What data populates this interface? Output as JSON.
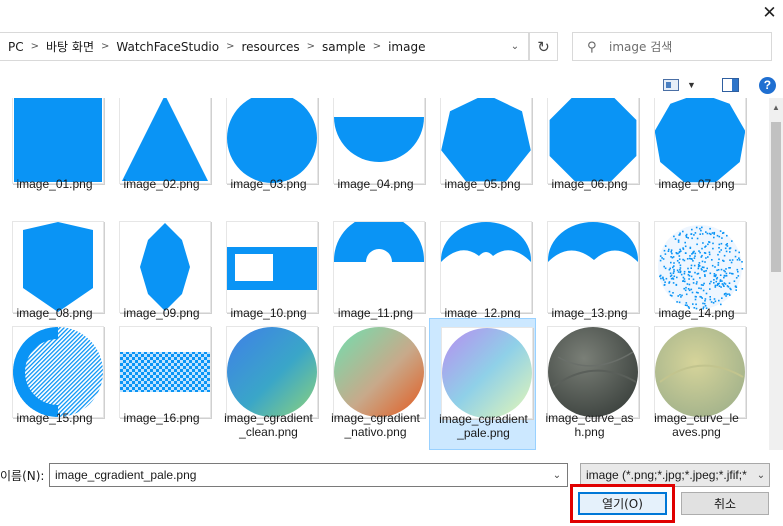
{
  "window": {
    "close_label": "✕"
  },
  "breadcrumb": {
    "items": [
      "PC",
      "바탕 화면",
      "WatchFaceStudio",
      "resources",
      "sample",
      "image"
    ]
  },
  "search": {
    "placeholder": "image 검색"
  },
  "files": [
    {
      "name": "image_01.png",
      "shape": "square"
    },
    {
      "name": "image_02.png",
      "shape": "triangle"
    },
    {
      "name": "image_03.png",
      "shape": "circle"
    },
    {
      "name": "image_04.png",
      "shape": "half-circle"
    },
    {
      "name": "image_05.png",
      "shape": "heptagon"
    },
    {
      "name": "image_06.png",
      "shape": "octagon"
    },
    {
      "name": "image_07.png",
      "shape": "nonagon"
    },
    {
      "name": "image_08.png",
      "shape": "shield"
    },
    {
      "name": "image_09.png",
      "shape": "lens"
    },
    {
      "name": "image_10.png",
      "shape": "frame"
    },
    {
      "name": "image_11.png",
      "shape": "arc"
    },
    {
      "name": "image_12.png",
      "shape": "double-arc"
    },
    {
      "name": "image_13.png",
      "shape": "double-arc-2"
    },
    {
      "name": "image_14.png",
      "shape": "noise-circle"
    },
    {
      "name": "image_15.png",
      "shape": "ring-half"
    },
    {
      "name": "image_16.png",
      "shape": "checker"
    },
    {
      "name": "image_cgradient_clean.png",
      "shape": "grad-clean"
    },
    {
      "name": "image_cgradient_nativo.png",
      "shape": "grad-nativo"
    },
    {
      "name": "image_cgradient_pale.png",
      "shape": "grad-pale",
      "selected": true
    },
    {
      "name": "image_curve_ash.png",
      "shape": "curve-ash"
    },
    {
      "name": "image_curve_leaves.png",
      "shape": "curve-leaves"
    }
  ],
  "footer": {
    "filename_label": "이름(N):",
    "filename_value": "image_cgradient_pale.png",
    "filetype_value": "image (*.png;*.jpg;*.jpeg;*.jfif;*",
    "open_label": "열기(O)",
    "cancel_label": "취소"
  },
  "colors": {
    "shape_blue": "#0a94f5",
    "selection": "#cce8ff",
    "highlight_border": "#e00000"
  }
}
